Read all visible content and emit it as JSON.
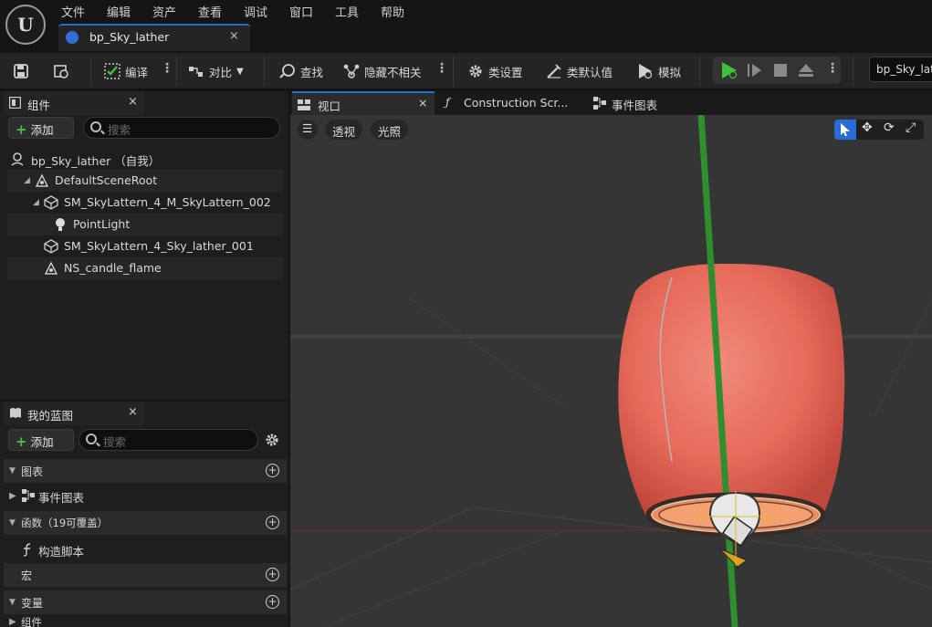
{
  "menu": [
    "文件",
    "编辑",
    "资产",
    "查看",
    "调试",
    "窗口",
    "工具",
    "帮助"
  ],
  "doc_tab": {
    "label": "bp_Sky_lather",
    "close": "×"
  },
  "toolbar": {
    "compile": "编译",
    "diff": "对比",
    "find": "查找",
    "hide_unrelated": "隐藏不相关",
    "class_settings": "类设置",
    "class_defaults": "类默认值",
    "simulate": "模拟",
    "asset_name": "bp_Sky_lat"
  },
  "components_panel": {
    "title": "组件",
    "close": "×",
    "add_label": "添加",
    "search_placeholder": "搜索",
    "tree": [
      {
        "label": "bp_Sky_lather （自我）"
      },
      {
        "label": "DefaultSceneRoot"
      },
      {
        "label": "SM_SkyLattern_4_M_SkyLattern_002"
      },
      {
        "label": "PointLight"
      },
      {
        "label": "SM_SkyLattern_4_Sky_lather_001"
      },
      {
        "label": "NS_candle_flame"
      }
    ]
  },
  "blueprint_panel": {
    "title": "我的蓝图",
    "close": "×",
    "add_label": "添加",
    "search_placeholder": "搜索",
    "sections": {
      "graphs": "图表",
      "event_graph": "事件图表",
      "functions": "函数（19可覆盖）",
      "construction_script": "构造脚本",
      "macros": "宏",
      "variables": "变量",
      "components": "组件"
    }
  },
  "viewport_tabs": {
    "viewport": "视口",
    "construction": "Construction Scr...",
    "event_graph": "事件图表",
    "close": "×"
  },
  "viewport": {
    "perspective": "透视",
    "lighting": "光照"
  },
  "colors": {
    "accent": "#2a6cd6",
    "play_green": "#3fbf3f",
    "lantern": "#e8695a"
  }
}
